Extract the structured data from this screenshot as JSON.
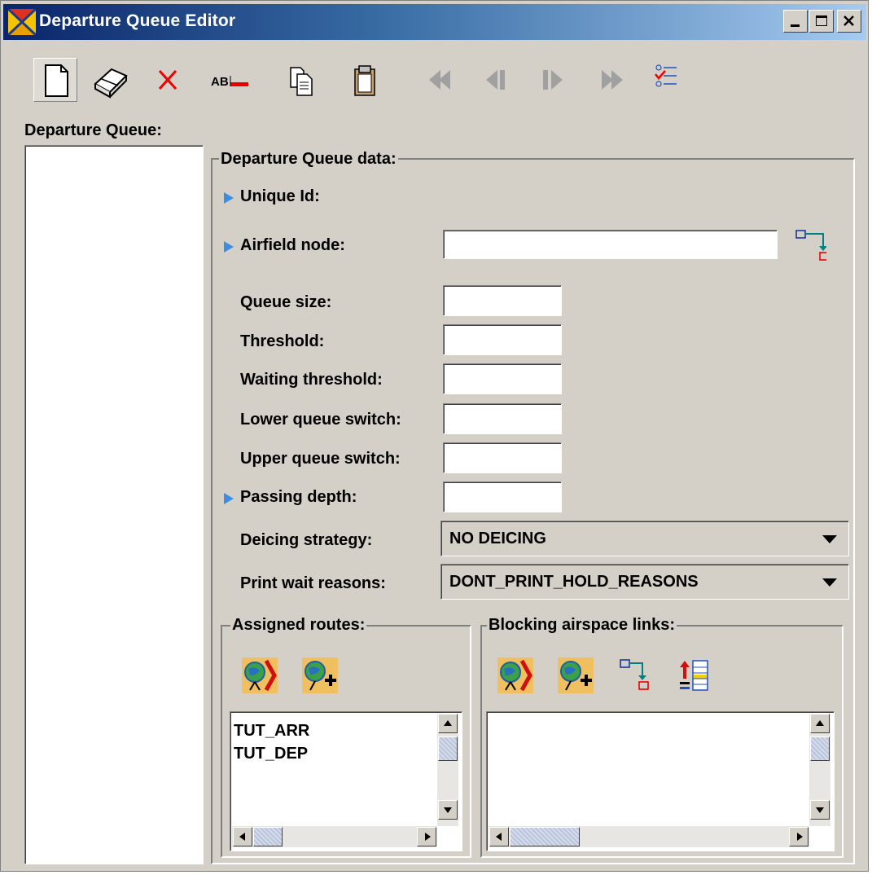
{
  "window": {
    "title": "Departure Queue Editor"
  },
  "toolbar": {
    "buttons": [
      "new-icon",
      "eraser-icon",
      "delete-icon",
      "rename-icon",
      "copy-icon",
      "paste-icon",
      "first-icon",
      "previous-icon",
      "next-icon",
      "last-icon",
      "checklist-icon"
    ]
  },
  "left_panel": {
    "label": "Departure Queue:"
  },
  "data_group": {
    "legend": "Departure Queue data:",
    "unique_id_label": "Unique Id:",
    "airfield_node_label": "Airfield node:",
    "airfield_node_value": "",
    "queue_size_label": "Queue size:",
    "queue_size_value": "",
    "threshold_label": "Threshold:",
    "threshold_value": "",
    "waiting_threshold_label": "Waiting threshold:",
    "waiting_threshold_value": "",
    "lower_queue_switch_label": "Lower queue switch:",
    "lower_queue_switch_value": "",
    "upper_queue_switch_label": "Upper queue switch:",
    "upper_queue_switch_value": "",
    "passing_depth_label": "Passing depth:",
    "passing_depth_value": "",
    "deicing_strategy_label": "Deicing strategy:",
    "deicing_strategy_value": "NO DEICING",
    "print_wait_reasons_label": "Print wait reasons:",
    "print_wait_reasons_value": "DONT_PRINT_HOLD_REASONS"
  },
  "assigned_routes": {
    "legend": "Assigned routes:",
    "items": [
      "TUT_ARR",
      "TUT_DEP"
    ]
  },
  "blocking_links": {
    "legend": "Blocking airspace links:",
    "items": []
  },
  "colors": {
    "title_start": "#0a246a",
    "title_end": "#a6caf0",
    "background": "#d4d0c8",
    "bullet": "#3d8ee0"
  }
}
